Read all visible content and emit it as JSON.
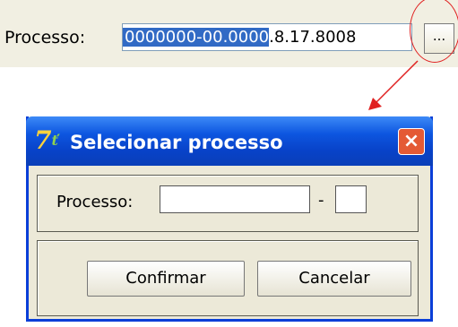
{
  "top": {
    "label": "Processo:",
    "value_selected": "0000000-00.0000",
    "value_rest": ".8.17.8008",
    "browse_label": "..."
  },
  "dialog": {
    "title": "Selecionar processo",
    "close_label": "×",
    "field_label": "Processo:",
    "field_separator": "-",
    "field_value": "",
    "field_suffix_value": "",
    "confirm_label": "Confirmar",
    "cancel_label": "Cancelar"
  },
  "colors": {
    "selection": "#316ac5",
    "callout": "#e02020",
    "titlebar": "#0d56e0",
    "close_button": "#e45a35",
    "dialog_bg": "#ece9d8"
  },
  "icons": {
    "app": "app-logo-icon",
    "close": "close-icon",
    "arrow": "callout-arrow"
  }
}
